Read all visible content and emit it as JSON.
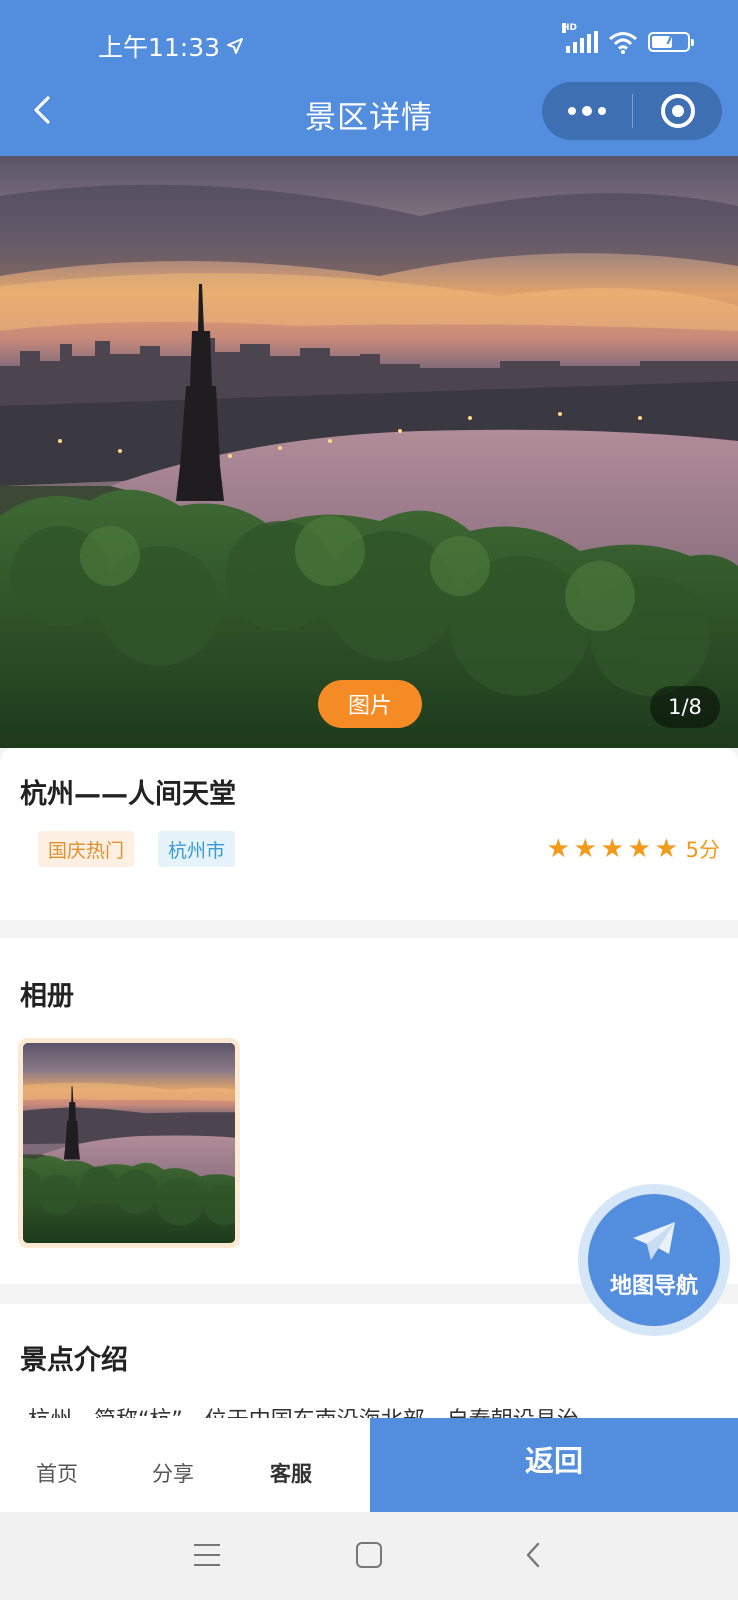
{
  "status_bar": {
    "time": "上午11:33",
    "network": "HD",
    "battery": "7",
    "icons": [
      "location-arrow-icon",
      "signal-icon",
      "wifi-icon",
      "battery-icon"
    ]
  },
  "nav": {
    "title": "景区详情",
    "back_icon": "chevron-left-icon",
    "more_icon": "more-dots-icon",
    "close_icon": "target-circle-icon"
  },
  "hero": {
    "tag": "图片",
    "counter": "1/8"
  },
  "info": {
    "title": "杭州——人间天堂",
    "tags": [
      "国庆热门",
      "杭州市"
    ],
    "rating_stars": 5,
    "score_text": "5分"
  },
  "album": {
    "title": "相册"
  },
  "intro": {
    "title": "景点介绍",
    "text": "杭州，简称“杭”，位于中国东南沿海北部，自秦朝设县治"
  },
  "float_button": {
    "label": "地图导航",
    "icon": "paper-plane-icon"
  },
  "action_bar": {
    "home": "首页",
    "share": "分享",
    "service": "客服",
    "return": "返回"
  },
  "colors": {
    "primary": "#538ddd",
    "accent_orange": "#f48b25",
    "star": "#f29a1c"
  }
}
